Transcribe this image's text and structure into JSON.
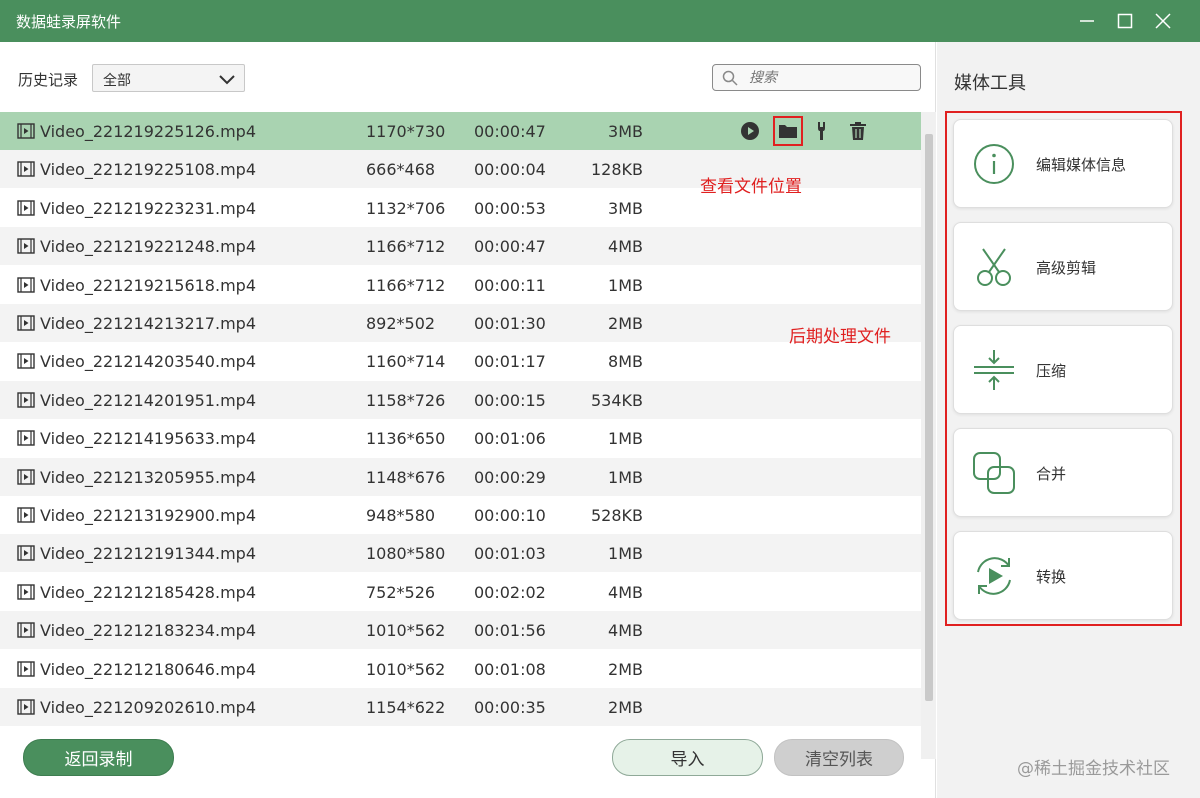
{
  "app": {
    "title": "数据蛙录屏软件"
  },
  "filter": {
    "label": "历史记录",
    "selected": "全部"
  },
  "search": {
    "placeholder": "搜索"
  },
  "files": [
    {
      "name": "Video_221219225126.mp4",
      "resolution": "1170*730",
      "duration": "00:00:47",
      "size": "3MB"
    },
    {
      "name": "Video_221219225108.mp4",
      "resolution": "666*468",
      "duration": "00:00:04",
      "size": "128KB"
    },
    {
      "name": "Video_221219223231.mp4",
      "resolution": "1132*706",
      "duration": "00:00:53",
      "size": "3MB"
    },
    {
      "name": "Video_221219221248.mp4",
      "resolution": "1166*712",
      "duration": "00:00:47",
      "size": "4MB"
    },
    {
      "name": "Video_221219215618.mp4",
      "resolution": "1166*712",
      "duration": "00:00:11",
      "size": "1MB"
    },
    {
      "name": "Video_221214213217.mp4",
      "resolution": "892*502",
      "duration": "00:01:30",
      "size": "2MB"
    },
    {
      "name": "Video_221214203540.mp4",
      "resolution": "1160*714",
      "duration": "00:01:17",
      "size": "8MB"
    },
    {
      "name": "Video_221214201951.mp4",
      "resolution": "1158*726",
      "duration": "00:00:15",
      "size": "534KB"
    },
    {
      "name": "Video_221214195633.mp4",
      "resolution": "1136*650",
      "duration": "00:01:06",
      "size": "1MB"
    },
    {
      "name": "Video_221213205955.mp4",
      "resolution": "1148*676",
      "duration": "00:00:29",
      "size": "1MB"
    },
    {
      "name": "Video_221213192900.mp4",
      "resolution": "948*580",
      "duration": "00:00:10",
      "size": "528KB"
    },
    {
      "name": "Video_221212191344.mp4",
      "resolution": "1080*580",
      "duration": "00:01:03",
      "size": "1MB"
    },
    {
      "name": "Video_221212185428.mp4",
      "resolution": "752*526",
      "duration": "00:02:02",
      "size": "4MB"
    },
    {
      "name": "Video_221212183234.mp4",
      "resolution": "1010*562",
      "duration": "00:01:56",
      "size": "4MB"
    },
    {
      "name": "Video_221212180646.mp4",
      "resolution": "1010*562",
      "duration": "00:01:08",
      "size": "2MB"
    },
    {
      "name": "Video_221209202610.mp4",
      "resolution": "1154*622",
      "duration": "00:00:35",
      "size": "2MB"
    }
  ],
  "annotations": {
    "view_location": "查看文件位置",
    "post_process": "后期处理文件"
  },
  "buttons": {
    "back": "返回录制",
    "import": "导入",
    "clear": "清空列表"
  },
  "media_tools": {
    "title": "媒体工具",
    "items": [
      {
        "label": "编辑媒体信息",
        "icon": "info-icon"
      },
      {
        "label": "高级剪辑",
        "icon": "scissors-icon"
      },
      {
        "label": "压缩",
        "icon": "compress-icon"
      },
      {
        "label": "合并",
        "icon": "merge-icon"
      },
      {
        "label": "转换",
        "icon": "convert-icon"
      }
    ]
  },
  "watermark": "@稀土掘金技术社区",
  "colors": {
    "accent": "#4a8f5d",
    "selected_row": "#a9d3b1",
    "annotation": "#e02020"
  }
}
